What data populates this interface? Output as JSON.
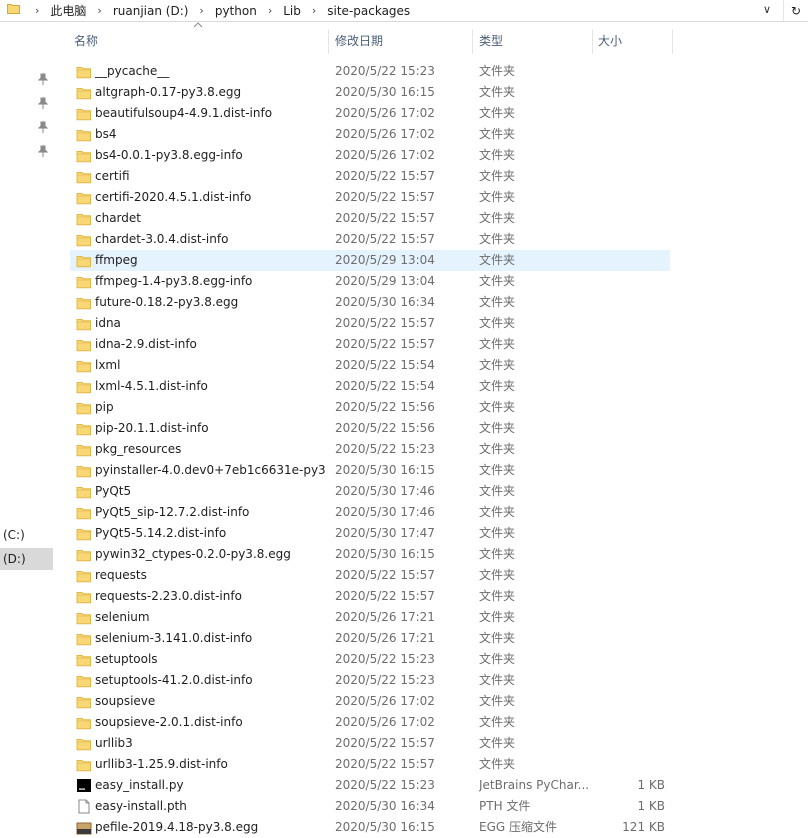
{
  "address": {
    "crumbs": [
      "此电脑",
      "ruanjian (D:)",
      "python",
      "Lib",
      "site-packages"
    ],
    "separator": "›",
    "dropdown_glyph": "∨",
    "refresh_glyph": "↻"
  },
  "nav": {
    "drives": [
      {
        "label": "(C:)",
        "selected": false
      },
      {
        "label": "(D:)",
        "selected": true
      }
    ]
  },
  "columns": {
    "name": "名称",
    "date": "修改日期",
    "type": "类型",
    "size": "大小"
  },
  "colors": {
    "folder": "#f8d775",
    "folder_edge": "#e0b84a",
    "hover_row": "#e5f3ff",
    "selected_nav": "#d9d9d9",
    "header_text": "#4c607a"
  },
  "files": [
    {
      "icon": "folder",
      "name": "__pycache__",
      "date": "2020/5/22 15:23",
      "type": "文件夹",
      "size": ""
    },
    {
      "icon": "folder",
      "name": "altgraph-0.17-py3.8.egg",
      "date": "2020/5/30 16:15",
      "type": "文件夹",
      "size": ""
    },
    {
      "icon": "folder",
      "name": "beautifulsoup4-4.9.1.dist-info",
      "date": "2020/5/26 17:02",
      "type": "文件夹",
      "size": ""
    },
    {
      "icon": "folder",
      "name": "bs4",
      "date": "2020/5/26 17:02",
      "type": "文件夹",
      "size": ""
    },
    {
      "icon": "folder",
      "name": "bs4-0.0.1-py3.8.egg-info",
      "date": "2020/5/26 17:02",
      "type": "文件夹",
      "size": ""
    },
    {
      "icon": "folder",
      "name": "certifi",
      "date": "2020/5/22 15:57",
      "type": "文件夹",
      "size": ""
    },
    {
      "icon": "folder",
      "name": "certifi-2020.4.5.1.dist-info",
      "date": "2020/5/22 15:57",
      "type": "文件夹",
      "size": ""
    },
    {
      "icon": "folder",
      "name": "chardet",
      "date": "2020/5/22 15:57",
      "type": "文件夹",
      "size": ""
    },
    {
      "icon": "folder",
      "name": "chardet-3.0.4.dist-info",
      "date": "2020/5/22 15:57",
      "type": "文件夹",
      "size": ""
    },
    {
      "icon": "folder",
      "name": "ffmpeg",
      "date": "2020/5/29 13:04",
      "type": "文件夹",
      "size": "",
      "hover": true
    },
    {
      "icon": "folder",
      "name": "ffmpeg-1.4-py3.8.egg-info",
      "date": "2020/5/29 13:04",
      "type": "文件夹",
      "size": ""
    },
    {
      "icon": "folder",
      "name": "future-0.18.2-py3.8.egg",
      "date": "2020/5/30 16:34",
      "type": "文件夹",
      "size": ""
    },
    {
      "icon": "folder",
      "name": "idna",
      "date": "2020/5/22 15:57",
      "type": "文件夹",
      "size": ""
    },
    {
      "icon": "folder",
      "name": "idna-2.9.dist-info",
      "date": "2020/5/22 15:57",
      "type": "文件夹",
      "size": ""
    },
    {
      "icon": "folder",
      "name": "lxml",
      "date": "2020/5/22 15:54",
      "type": "文件夹",
      "size": ""
    },
    {
      "icon": "folder",
      "name": "lxml-4.5.1.dist-info",
      "date": "2020/5/22 15:54",
      "type": "文件夹",
      "size": ""
    },
    {
      "icon": "folder",
      "name": "pip",
      "date": "2020/5/22 15:56",
      "type": "文件夹",
      "size": ""
    },
    {
      "icon": "folder",
      "name": "pip-20.1.1.dist-info",
      "date": "2020/5/22 15:56",
      "type": "文件夹",
      "size": ""
    },
    {
      "icon": "folder",
      "name": "pkg_resources",
      "date": "2020/5/22 15:23",
      "type": "文件夹",
      "size": ""
    },
    {
      "icon": "folder",
      "name": "pyinstaller-4.0.dev0+7eb1c6631e-py3...",
      "date": "2020/5/30 16:15",
      "type": "文件夹",
      "size": ""
    },
    {
      "icon": "folder",
      "name": "PyQt5",
      "date": "2020/5/30 17:46",
      "type": "文件夹",
      "size": ""
    },
    {
      "icon": "folder",
      "name": "PyQt5_sip-12.7.2.dist-info",
      "date": "2020/5/30 17:46",
      "type": "文件夹",
      "size": ""
    },
    {
      "icon": "folder",
      "name": "PyQt5-5.14.2.dist-info",
      "date": "2020/5/30 17:47",
      "type": "文件夹",
      "size": ""
    },
    {
      "icon": "folder",
      "name": "pywin32_ctypes-0.2.0-py3.8.egg",
      "date": "2020/5/30 16:15",
      "type": "文件夹",
      "size": ""
    },
    {
      "icon": "folder",
      "name": "requests",
      "date": "2020/5/22 15:57",
      "type": "文件夹",
      "size": ""
    },
    {
      "icon": "folder",
      "name": "requests-2.23.0.dist-info",
      "date": "2020/5/22 15:57",
      "type": "文件夹",
      "size": ""
    },
    {
      "icon": "folder",
      "name": "selenium",
      "date": "2020/5/26 17:21",
      "type": "文件夹",
      "size": ""
    },
    {
      "icon": "folder",
      "name": "selenium-3.141.0.dist-info",
      "date": "2020/5/26 17:21",
      "type": "文件夹",
      "size": ""
    },
    {
      "icon": "folder",
      "name": "setuptools",
      "date": "2020/5/22 15:23",
      "type": "文件夹",
      "size": ""
    },
    {
      "icon": "folder",
      "name": "setuptools-41.2.0.dist-info",
      "date": "2020/5/22 15:23",
      "type": "文件夹",
      "size": ""
    },
    {
      "icon": "folder",
      "name": "soupsieve",
      "date": "2020/5/26 17:02",
      "type": "文件夹",
      "size": ""
    },
    {
      "icon": "folder",
      "name": "soupsieve-2.0.1.dist-info",
      "date": "2020/5/26 17:02",
      "type": "文件夹",
      "size": ""
    },
    {
      "icon": "folder",
      "name": "urllib3",
      "date": "2020/5/22 15:57",
      "type": "文件夹",
      "size": ""
    },
    {
      "icon": "folder",
      "name": "urllib3-1.25.9.dist-info",
      "date": "2020/5/22 15:57",
      "type": "文件夹",
      "size": ""
    },
    {
      "icon": "pycharm",
      "name": "easy_install.py",
      "date": "2020/5/22 15:23",
      "type": "JetBrains PyChar...",
      "size": "1 KB"
    },
    {
      "icon": "file",
      "name": "easy-install.pth",
      "date": "2020/5/30 16:34",
      "type": "PTH 文件",
      "size": "1 KB"
    },
    {
      "icon": "egg",
      "name": "pefile-2019.4.18-py3.8.egg",
      "date": "2020/5/30 16:15",
      "type": "EGG 压缩文件",
      "size": "121 KB"
    }
  ]
}
